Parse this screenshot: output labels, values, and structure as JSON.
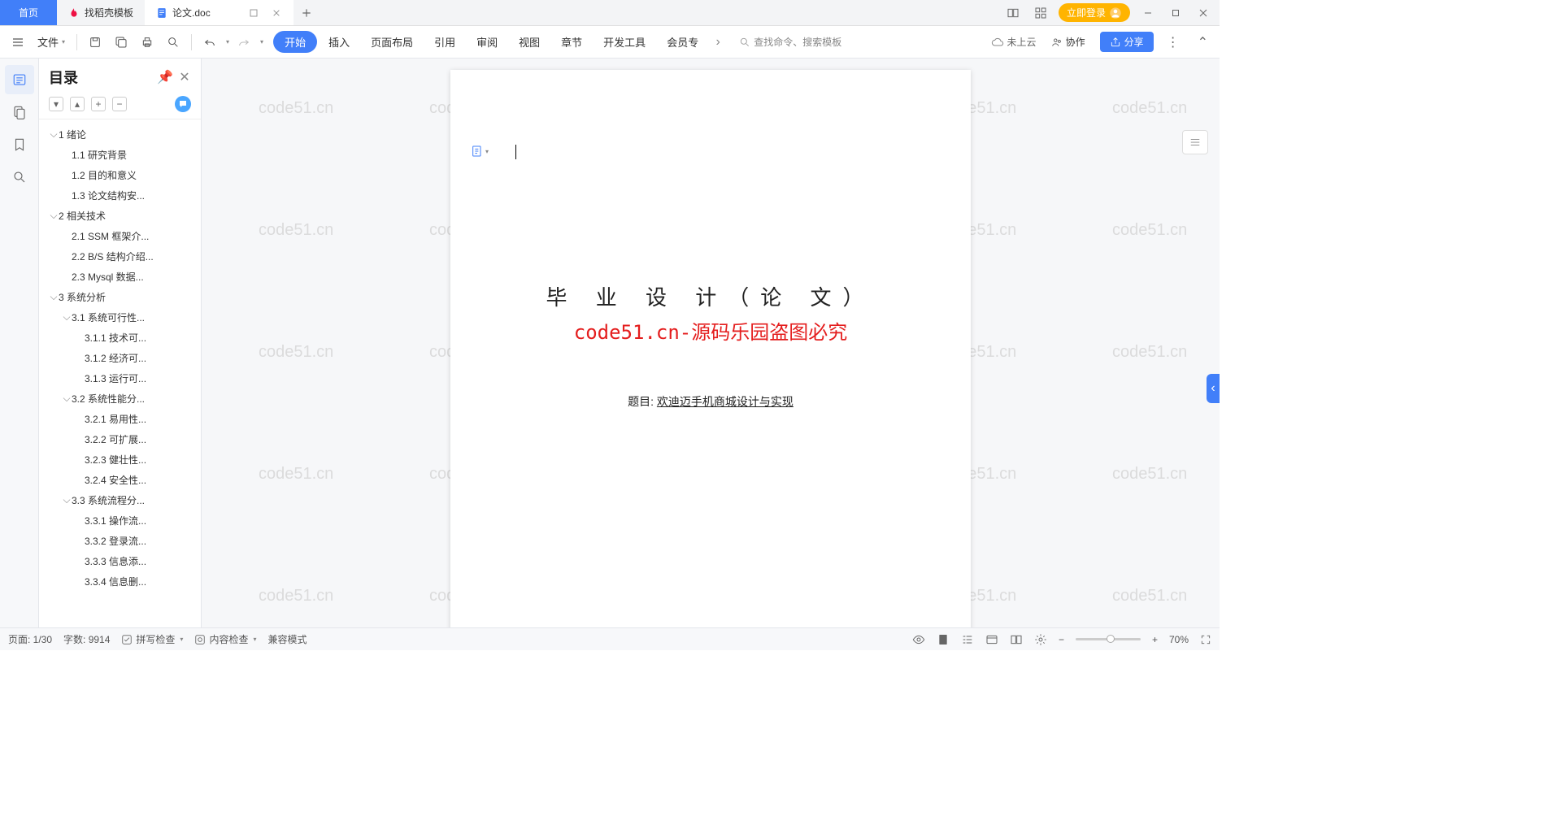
{
  "tabs": {
    "home": "首页",
    "template": "找稻壳模板",
    "doc": "论文.doc"
  },
  "window": {
    "login": "立即登录"
  },
  "ribbon": {
    "file": "文件",
    "tabs": [
      "开始",
      "插入",
      "页面布局",
      "引用",
      "审阅",
      "视图",
      "章节",
      "开发工具",
      "会员专"
    ],
    "search_placeholder": "查找命令、搜索模板",
    "cloud": "未上云",
    "coop": "协作",
    "share": "分享"
  },
  "outline": {
    "title": "目录",
    "items": [
      {
        "lv": 1,
        "chev": true,
        "text": "1 绪论"
      },
      {
        "lv": 2,
        "chev": false,
        "text": "1.1 研究背景"
      },
      {
        "lv": 2,
        "chev": false,
        "text": "1.2 目的和意义"
      },
      {
        "lv": 2,
        "chev": false,
        "text": "1.3 论文结构安..."
      },
      {
        "lv": 1,
        "chev": true,
        "text": "2 相关技术"
      },
      {
        "lv": 2,
        "chev": false,
        "text": "2.1 SSM 框架介..."
      },
      {
        "lv": 2,
        "chev": false,
        "text": "2.2 B/S 结构介绍..."
      },
      {
        "lv": 2,
        "chev": false,
        "text": "2.3 Mysql 数据..."
      },
      {
        "lv": 1,
        "chev": true,
        "text": "3 系统分析"
      },
      {
        "lv": 2,
        "chev": true,
        "text": "3.1 系统可行性..."
      },
      {
        "lv": 3,
        "chev": false,
        "text": "3.1.1 技术可..."
      },
      {
        "lv": 3,
        "chev": false,
        "text": "3.1.2 经济可..."
      },
      {
        "lv": 3,
        "chev": false,
        "text": "3.1.3 运行可..."
      },
      {
        "lv": 2,
        "chev": true,
        "text": "3.2 系统性能分..."
      },
      {
        "lv": 3,
        "chev": false,
        "text": "3.2.1 易用性..."
      },
      {
        "lv": 3,
        "chev": false,
        "text": "3.2.2 可扩展..."
      },
      {
        "lv": 3,
        "chev": false,
        "text": "3.2.3 健壮性..."
      },
      {
        "lv": 3,
        "chev": false,
        "text": "3.2.4 安全性..."
      },
      {
        "lv": 2,
        "chev": true,
        "text": "3.3 系统流程分..."
      },
      {
        "lv": 3,
        "chev": false,
        "text": "3.3.1 操作流..."
      },
      {
        "lv": 3,
        "chev": false,
        "text": "3.3.2 登录流..."
      },
      {
        "lv": 3,
        "chev": false,
        "text": "3.3.3 信息添..."
      },
      {
        "lv": 3,
        "chev": false,
        "text": "3.3.4 信息删..."
      }
    ]
  },
  "document": {
    "title": "毕 业 设 计（论 文）",
    "watermark_red": "code51.cn-源码乐园盗图必究",
    "subject_label": "题目:",
    "subject_value": "欢迪迈手机商城设计与实现",
    "bg_watermark": "code51.cn"
  },
  "status": {
    "page": "页面: 1/30",
    "words": "字数: 9914",
    "spellcheck": "拼写检查",
    "contentcheck": "内容检查",
    "compat": "兼容模式",
    "zoom": "70%"
  }
}
